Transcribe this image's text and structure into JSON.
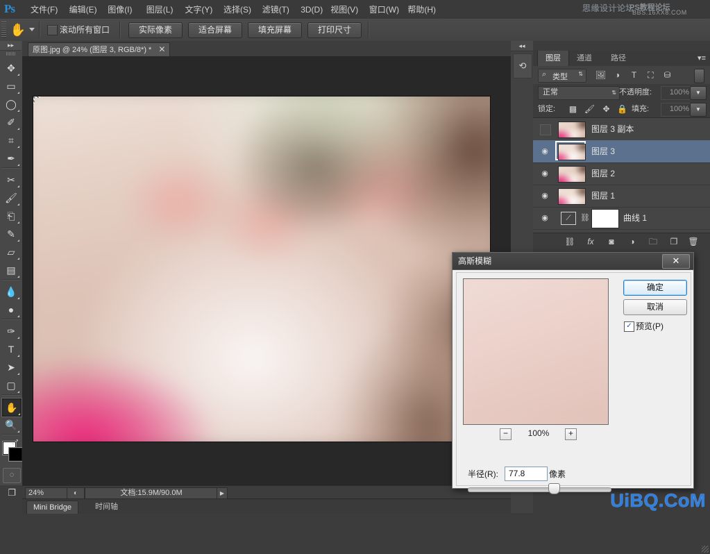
{
  "app": {
    "logo": "Ps",
    "menu": [
      "文件(F)",
      "编辑(E)",
      "图像(I)",
      "图层(L)",
      "文字(Y)",
      "选择(S)",
      "滤镜(T)",
      "3D(D)",
      "视图(V)",
      "窗口(W)",
      "帮助(H)"
    ],
    "watermark_top_line1": "思缘设计论坛",
    "watermark_top_line2": "PS教程论坛",
    "watermark_top_line3": "BBS.16XX8.COM",
    "watermark_bottom": "UiBQ.CoM"
  },
  "options_bar": {
    "tool_icon": "hand-tool-icon",
    "scroll_all_windows_label": "滚动所有窗口",
    "scroll_all_windows_checked": false,
    "buttons": [
      "实际像素",
      "适合屏幕",
      "填充屏幕",
      "打印尺寸"
    ]
  },
  "toolbox": {
    "tools": [
      {
        "name": "move-tool",
        "glyph": "✥"
      },
      {
        "name": "rectangular-marquee-tool",
        "glyph": "▭"
      },
      {
        "name": "lasso-tool",
        "glyph": "◯"
      },
      {
        "name": "quick-selection-tool",
        "glyph": "✐"
      },
      {
        "name": "crop-tool",
        "glyph": "⌗"
      },
      {
        "name": "eyedropper-tool",
        "glyph": "✒"
      },
      {
        "name": "spot-healing-brush-tool",
        "glyph": "✂"
      },
      {
        "name": "brush-tool",
        "glyph": "🖌"
      },
      {
        "name": "clone-stamp-tool",
        "glyph": "⎗"
      },
      {
        "name": "history-brush-tool",
        "glyph": "✎"
      },
      {
        "name": "eraser-tool",
        "glyph": "▱"
      },
      {
        "name": "gradient-tool",
        "glyph": "▤"
      },
      {
        "name": "blur-tool",
        "glyph": "💧"
      },
      {
        "name": "dodge-tool",
        "glyph": "●"
      },
      {
        "name": "pen-tool",
        "glyph": "✑"
      },
      {
        "name": "horizontal-type-tool",
        "glyph": "T"
      },
      {
        "name": "path-selection-tool",
        "glyph": "➤"
      },
      {
        "name": "rectangle-tool",
        "glyph": "▢"
      },
      {
        "name": "hand-tool",
        "glyph": "✋"
      },
      {
        "name": "zoom-tool",
        "glyph": "🔍"
      }
    ],
    "active_tool": "hand-tool",
    "foreground_color": "#ffffff",
    "background_color": "#000000",
    "quick_mask_name": "quick-mask-toggle"
  },
  "document": {
    "tab_title": "原图.jpg @ 24% (图层 3, RGB/8*) *",
    "close_glyph": "✕"
  },
  "status_bar": {
    "zoom": "24%",
    "doc_info": "文档:15.9M/90.0M",
    "arrow_glyph": "▶"
  },
  "bottom_dock": {
    "tabs": [
      "Mini Bridge",
      "时间轴"
    ],
    "selected": "Mini Bridge"
  },
  "layers_panel": {
    "tabs": [
      "图层",
      "通道",
      "路径"
    ],
    "selected_tab": "图层",
    "menu_glyph": "▾≡",
    "filter": {
      "search_glyph": "⌕",
      "kind_label": "类型",
      "icons": [
        "pixel-filter-icon",
        "adjustment-filter-icon",
        "type-filter-icon",
        "shape-filter-icon",
        "smart-object-filter-icon"
      ]
    },
    "blend_mode": "正常",
    "opacity_label": "不透明度:",
    "opacity_value": "100%",
    "lock_label": "锁定:",
    "lock_icons": [
      "lock-transparent-pixels-icon",
      "lock-image-pixels-icon",
      "lock-position-icon",
      "lock-all-icon"
    ],
    "fill_label": "填充:",
    "fill_value": "100%",
    "rows": [
      {
        "name": "图层 3 副本",
        "visible": false,
        "selected": false,
        "kind": "pixel"
      },
      {
        "name": "图层 3",
        "visible": true,
        "selected": true,
        "kind": "pixel"
      },
      {
        "name": "图层 2",
        "visible": true,
        "selected": false,
        "kind": "pixel"
      },
      {
        "name": "图层 1",
        "visible": true,
        "selected": false,
        "kind": "pixel"
      },
      {
        "name": "曲线 1",
        "visible": true,
        "selected": false,
        "kind": "adjustment"
      }
    ],
    "footer_buttons": [
      {
        "name": "link-layers-button",
        "glyph": "⛓"
      },
      {
        "name": "layer-style-button",
        "glyph": "fx"
      },
      {
        "name": "add-layer-mask-button",
        "glyph": "◙"
      },
      {
        "name": "new-fill-adjustment-layer-button",
        "glyph": "◑"
      },
      {
        "name": "new-group-button",
        "glyph": "🗀"
      },
      {
        "name": "new-layer-button",
        "glyph": "❐"
      },
      {
        "name": "delete-layer-button",
        "glyph": "🗑"
      }
    ]
  },
  "dialog": {
    "title": "高斯模糊",
    "close_glyph": "✕",
    "ok_label": "确定",
    "cancel_label": "取消",
    "preview_label": "预览(P)",
    "preview_checked": true,
    "preview_check_glyph": "✓",
    "zoom_minus": "−",
    "zoom_value": "100%",
    "zoom_plus": "+",
    "radius_label": "半径(R):",
    "radius_value": "77.8",
    "radius_unit": "像素"
  }
}
